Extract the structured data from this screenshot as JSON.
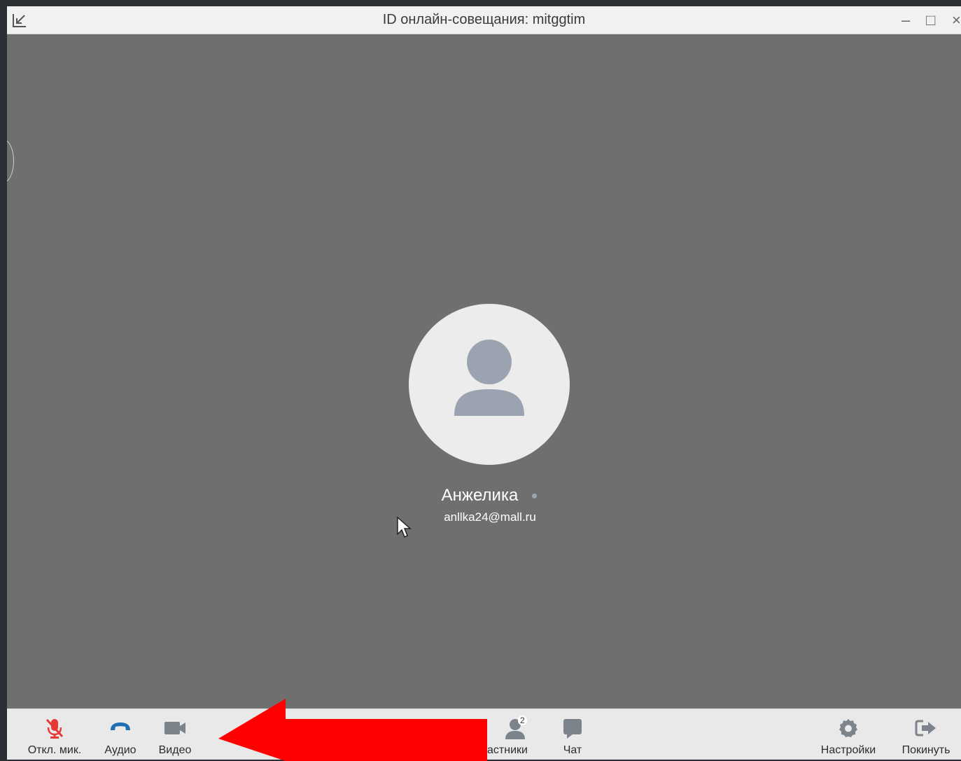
{
  "window": {
    "title": "ID онлайн-совещания: mitggtim",
    "controls": [
      "–",
      "□",
      "×"
    ]
  },
  "participant": {
    "name": "Анжелика",
    "email": "anllka24@mall.ru",
    "status_color": "#9aa3b1"
  },
  "toolbar": {
    "mute_label": "Откл. мик.",
    "audio_label": "Аудио",
    "video_label": "Видео",
    "participants_label": "астники",
    "participants_count": "2",
    "chat_label": "Чат",
    "settings_label": "Настройки",
    "leave_label": "Покинуть"
  },
  "colors": {
    "mute_icon": "#e53935",
    "audio_icon": "#1f6fb2",
    "arrow": "#ff0000"
  }
}
